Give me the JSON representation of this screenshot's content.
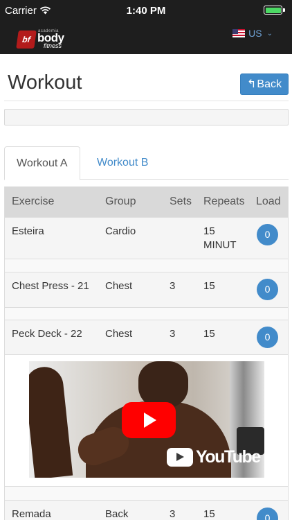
{
  "status_bar": {
    "carrier": "Carrier",
    "time": "1:40 PM",
    "battery_color": "#4cd964"
  },
  "header": {
    "logo": {
      "small": "academia",
      "main": "body",
      "sub": "fitness",
      "badge": "bf"
    },
    "language": "US",
    "flag_icon": "us-flag-icon",
    "background": "#1e1e1e"
  },
  "page": {
    "title": "Workout",
    "back_label": "Back",
    "accent": "#428bca"
  },
  "tabs": [
    {
      "label": "Workout A",
      "active": true
    },
    {
      "label": "Workout B",
      "active": false
    }
  ],
  "table": {
    "columns": [
      "Exercise",
      "Group",
      "Sets",
      "Repeats",
      "Load"
    ],
    "rows": [
      {
        "exercise": "Esteira",
        "group": "Cardio",
        "sets": "",
        "repeats": "15 MINUT",
        "load": "0"
      },
      {
        "exercise": "Chest Press - 21",
        "group": "Chest",
        "sets": "3",
        "repeats": "15",
        "load": "0"
      },
      {
        "exercise": "Peck Deck - 22",
        "group": "Chest",
        "sets": "3",
        "repeats": "15",
        "load": "0",
        "has_video": true
      },
      {
        "exercise": "Remada",
        "group": "Back",
        "sets": "3",
        "repeats": "15",
        "load": "0"
      }
    ]
  },
  "video": {
    "brand": "YouTube",
    "play_icon": "play-icon"
  }
}
